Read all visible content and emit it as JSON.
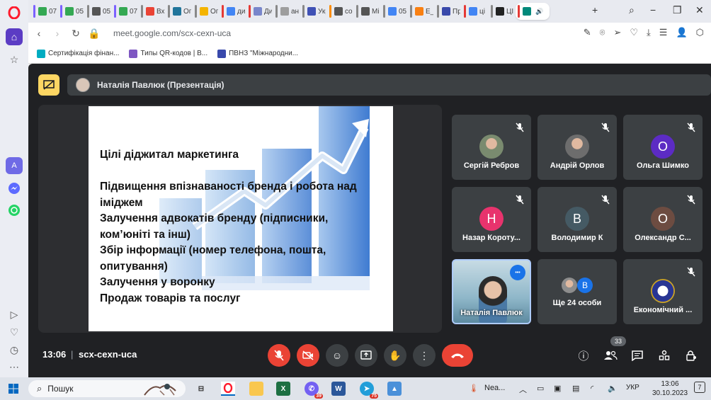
{
  "browser": {
    "tabs": [
      {
        "label": "07",
        "color": "#7b61ff",
        "favicon": "plus-square",
        "fav_color": "#34a853"
      },
      {
        "label": "05",
        "color": "#7b61ff",
        "favicon": "plus-square",
        "fav_color": "#34a853"
      },
      {
        "label": "05",
        "color": "#888",
        "favicon": "globe",
        "fav_color": "#555"
      },
      {
        "label": "07",
        "color": "#7b61ff",
        "favicon": "plus-square",
        "fav_color": "#34a853"
      },
      {
        "label": "Вхі",
        "color": "#888",
        "favicon": "gmail",
        "fav_color": "#ea4335"
      },
      {
        "label": "Ог",
        "color": "#888",
        "favicon": "wordpress",
        "fav_color": "#21759b"
      },
      {
        "label": "Ог",
        "color": "#888",
        "favicon": "globe",
        "fav_color": "#f4b400"
      },
      {
        "label": "ди",
        "color": "#e53935",
        "favicon": "google",
        "fav_color": "#4285f4"
      },
      {
        "label": "Ди",
        "color": "#e53935",
        "favicon": "globe",
        "fav_color": "#7986cb"
      },
      {
        "label": "ані",
        "color": "#888",
        "favicon": "globe",
        "fav_color": "#9e9e9e"
      },
      {
        "label": "Укр",
        "color": "#888",
        "favicon": "shield",
        "fav_color": "#3f51b5"
      },
      {
        "label": "cor",
        "color": "#fb8c00",
        "favicon": "globe",
        "fav_color": "#555"
      },
      {
        "label": "Мі",
        "color": "#888",
        "favicon": "globe",
        "fav_color": "#555"
      },
      {
        "label": "05",
        "color": "#888",
        "favicon": "google",
        "fav_color": "#4285f4"
      },
      {
        "label": "Е_с",
        "color": "#888",
        "favicon": "moodle",
        "fav_color": "#f98012"
      },
      {
        "label": "Пр",
        "color": "#888",
        "favicon": "oc",
        "fav_color": "#3949ab"
      },
      {
        "label": "ці",
        "color": "#e53935",
        "favicon": "google",
        "fav_color": "#4285f4"
      },
      {
        "label": "ЦІ",
        "color": "#888",
        "favicon": "dw",
        "fav_color": "#222"
      },
      {
        "label": "",
        "color": "#e53935",
        "favicon": "meet",
        "fav_color": "#00897b"
      }
    ],
    "url": "meet.google.com/scx-cexn-uca",
    "bookmarks": [
      {
        "label": "Сертифікація фінан...",
        "color": "#00acc1"
      },
      {
        "label": "Типы QR-кодов | В...",
        "color": "#7e57c2"
      },
      {
        "label": "ПВНЗ \"Міжнародни...",
        "color": "#3949ab"
      }
    ]
  },
  "meet": {
    "presenter_label": "Наталія Павлюк (Презентація)",
    "slide": {
      "lines": [
        "Цілі діджитал маркетинга",
        "",
        "Підвищення впізнаваності бренда і робота над",
        "іміджем",
        "Залучення адвокатів бренду (підписники,",
        "ком’юніті та інш)",
        "Збір інформації (номер телефона, пошта,",
        "опитування)",
        "Залучення у воронку",
        "Продаж товарів та послуг"
      ]
    },
    "participants": [
      {
        "name": "Сергій Ребров",
        "initial": "",
        "avatar": "photo",
        "color": "#7a8b6f",
        "muted": true
      },
      {
        "name": "Андрій Орлов",
        "initial": "",
        "avatar": "photo",
        "color": "#6d6d6d",
        "muted": true
      },
      {
        "name": "Ольга Шимко",
        "initial": "О",
        "avatar": "letter",
        "color": "#5c2bc4",
        "muted": true
      },
      {
        "name": "Назар Короту...",
        "initial": "Н",
        "avatar": "letter",
        "color": "#e8336d",
        "muted": true
      },
      {
        "name": "Володимир К",
        "initial": "В",
        "avatar": "letter",
        "color": "#455a64",
        "muted": true
      },
      {
        "name": "Олександр С...",
        "initial": "О",
        "avatar": "letter",
        "color": "#6d4c41",
        "muted": true
      },
      {
        "name": "Наталія Павлюк",
        "initial": "",
        "avatar": "video",
        "color": "#8fb7c9",
        "muted": false
      },
      {
        "name": "Ще 24 особи",
        "initial": "В",
        "avatar": "group",
        "color": "#1a73e8",
        "muted": false
      },
      {
        "name": "Економічний ...",
        "initial": "",
        "avatar": "emblem",
        "color": "#283593",
        "muted": true
      }
    ],
    "clock": "13:06",
    "separator": "|",
    "meeting_code": "scx-cexn-uca",
    "people_count": "33"
  },
  "taskbar": {
    "search_label": "Пошук",
    "weather_label": "Nea...",
    "lang": "УКР",
    "time": "13:06",
    "date": "30.10.2023",
    "notif_count": "7",
    "viber_badge": "39",
    "telegram_badge": "75"
  }
}
